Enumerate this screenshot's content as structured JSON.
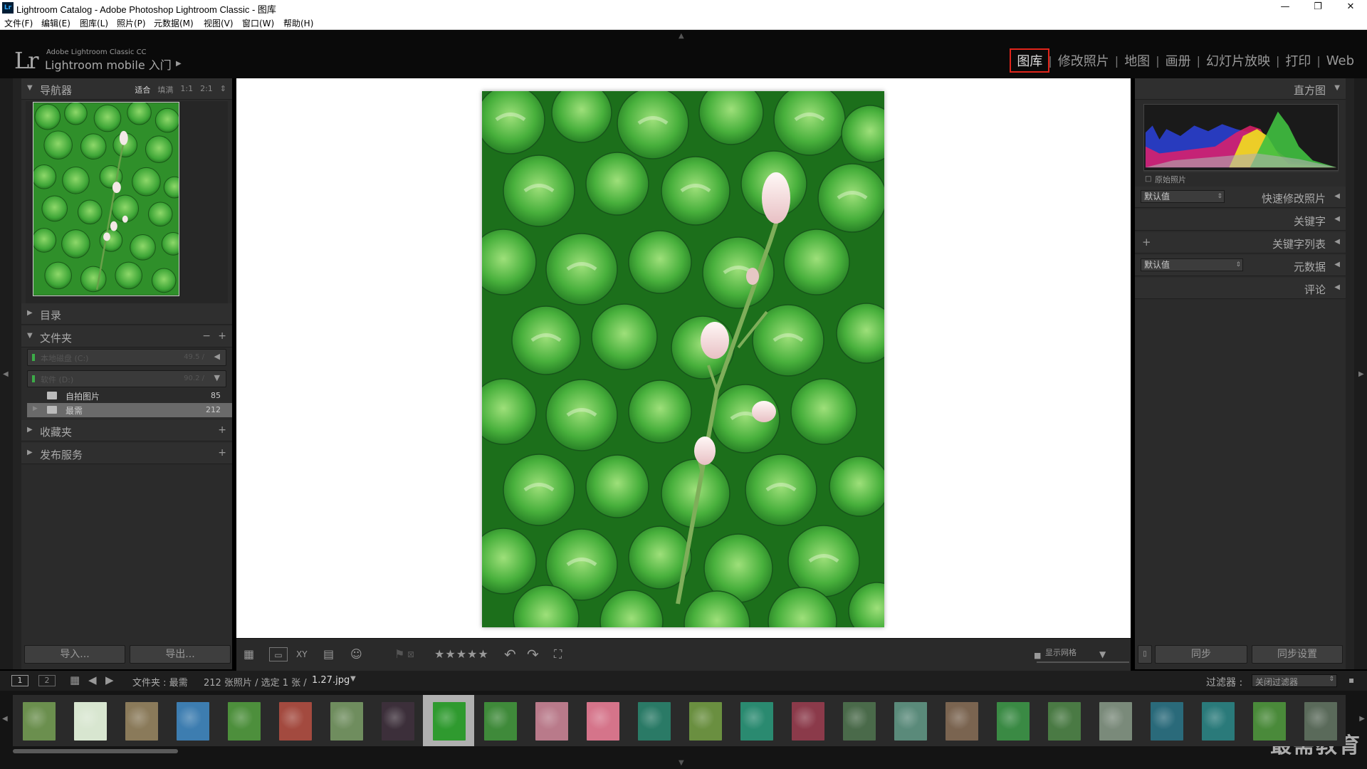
{
  "window": {
    "title": "Lightroom Catalog - Adobe Photoshop Lightroom Classic - 图库",
    "app_icon": "Lr",
    "controls": {
      "minimize": "—",
      "restore": "❐",
      "close": "✕"
    }
  },
  "menu": [
    "文件(F)",
    "编辑(E)",
    "图库(L)",
    "照片(P)",
    "元数据(M)",
    "视图(V)",
    "窗口(W)",
    "帮助(H)"
  ],
  "identity": {
    "logo": "Lr",
    "small": "Adobe Lightroom Classic CC",
    "brand": "Lightroom mobile 入门"
  },
  "modules": [
    "图库",
    "修改照片",
    "地图",
    "画册",
    "幻灯片放映",
    "打印",
    "Web"
  ],
  "active_module": "图库",
  "left": {
    "navigator": {
      "title": "导航器",
      "zoom_options": [
        "适合",
        "填满",
        "1:1",
        "2:1"
      ],
      "selected_zoom": "适合"
    },
    "catalog": {
      "title": "目录"
    },
    "folders": {
      "title": "文件夹",
      "controls": {
        "minus": "−",
        "plus": "+"
      },
      "volumes": [
        {
          "name": "本地磁盘 (C:)",
          "size": "49.5 /"
        },
        {
          "name": "软件 (D:)",
          "size": "90.2 /"
        }
      ],
      "items": [
        {
          "name": "自拍图片",
          "count": "85"
        },
        {
          "name": "最需",
          "count": "212"
        }
      ]
    },
    "collections": {
      "title": "收藏夹",
      "plus": "+"
    },
    "publish": {
      "title": "发布服务",
      "plus": "+"
    },
    "import_label": "导入...",
    "export_label": "导出..."
  },
  "toolbar": {
    "show_grid_label": "显示网格",
    "stars": "★★★★★"
  },
  "right": {
    "histogram": {
      "title": "直方图",
      "original_label": "原始照片"
    },
    "quick_develop": {
      "preset": "默认值",
      "label": "快速修改照片"
    },
    "keywording": {
      "label": "关键字"
    },
    "keyword_list": {
      "label": "关键字列表",
      "plus": "+"
    },
    "metadata": {
      "preset": "默认值",
      "label": "元数据"
    },
    "comments": {
      "label": "评论"
    },
    "sync_label": "同步",
    "sync_settings_label": "同步设置"
  },
  "filmstrip": {
    "view1": "1",
    "view2": "2",
    "source_label": "文件夹 : 最需",
    "count_label": "212 张照片 / 选定 1 张 /",
    "filename": "1.27.jpg",
    "filter_label": "过滤器 :",
    "filter_value": "关闭过滤器",
    "selected_index": 8,
    "thumbs": [
      "#6b8f4e",
      "#d8e6d0",
      "#8a7a5a",
      "#3d7db0",
      "#4d8f3c",
      "#a34a3f",
      "#6f8d5e",
      "#3c2f3a",
      "#2f9a2f",
      "#3f8a3a",
      "#b97a8a",
      "#d5748a",
      "#2a7a66",
      "#6a8f40",
      "#2a8a70",
      "#8b3a4a",
      "#4a6a4a",
      "#5a8a7a",
      "#7a6450",
      "#3a8a44",
      "#4a7a44",
      "#7a8a7a",
      "#2a6a7a",
      "#2a7a7a",
      "#4a8a3a",
      "#5a6a5a"
    ]
  },
  "watermark": "最需教育",
  "colors": {
    "accent_highlight": "#e1251b",
    "panel": "#2b2b2b",
    "background": "#000000"
  }
}
